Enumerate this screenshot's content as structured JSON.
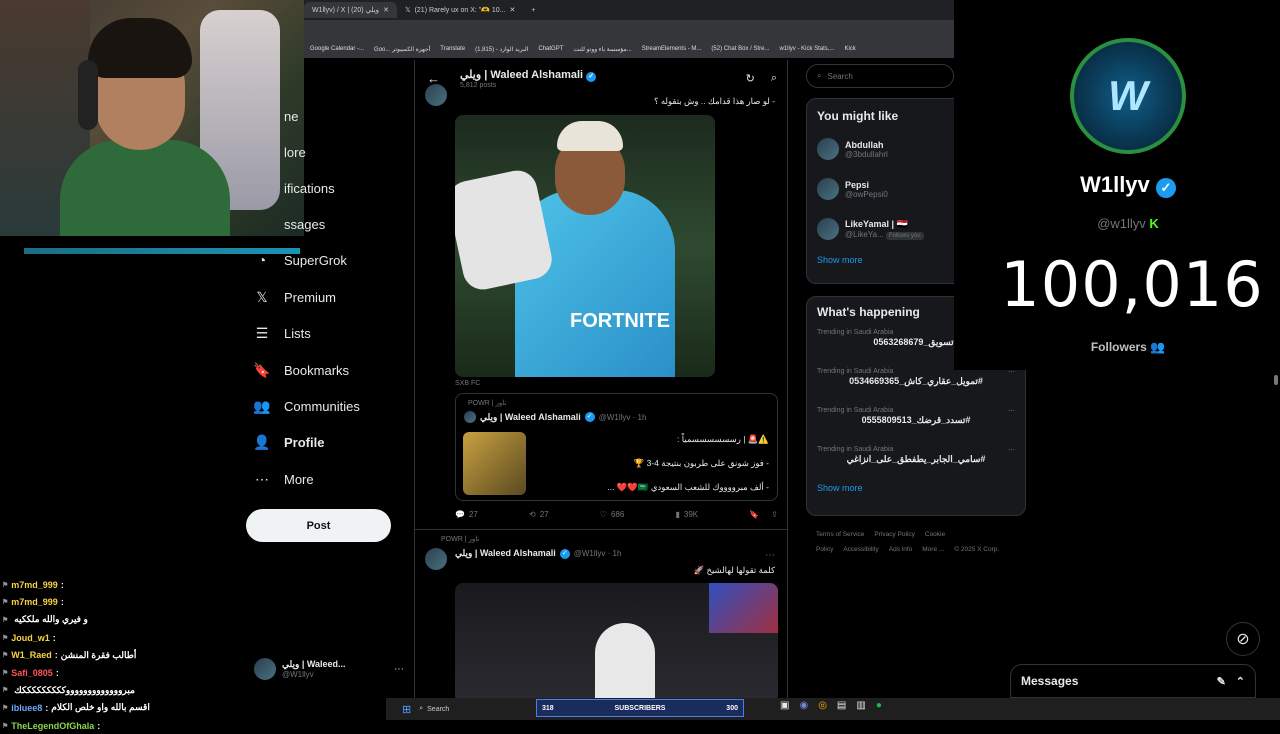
{
  "browser": {
    "tabs": [
      {
        "label": "W1llyv) / X | ويلي (20)"
      },
      {
        "label": "(21) Rarely ux on X: \"🫶 10..."
      }
    ],
    "bookmarks": [
      "Google Calendar -...",
      "Goo... أجهزة الكمبيوتر",
      "Translate",
      "البريد الوارد - (1,815)",
      "ChatGPT",
      "مؤسسة باء ووتو للنت...",
      "StreamElements - M...",
      "(52) Chat Box / Stre...",
      "w1llyv - Kick Stats,...",
      "Kick"
    ]
  },
  "nav": {
    "items": [
      {
        "label": "Home",
        "icon": "home-icon",
        "glyph": "⌂"
      },
      {
        "label": "Explore",
        "icon": "explore-icon",
        "glyph": "⌕"
      },
      {
        "label": "Notifications",
        "icon": "bell-icon",
        "glyph": "🔔"
      },
      {
        "label": "Messages",
        "icon": "envelope-icon",
        "glyph": "✉"
      },
      {
        "label": "SuperGrok",
        "icon": "grok-icon",
        "glyph": "◔"
      },
      {
        "label": "Premium",
        "icon": "x-logo-icon",
        "glyph": "𝕏"
      },
      {
        "label": "Lists",
        "icon": "lists-icon",
        "glyph": "☰"
      },
      {
        "label": "Bookmarks",
        "icon": "bookmark-icon",
        "glyph": "🔖"
      },
      {
        "label": "Communities",
        "icon": "communities-icon",
        "glyph": "👥"
      },
      {
        "label": "Profile",
        "icon": "profile-icon",
        "glyph": "👤"
      },
      {
        "label": "More",
        "icon": "more-circle-icon",
        "glyph": "⋯"
      }
    ],
    "visible_labels": [
      "ne",
      "lore",
      "ifications",
      "ssages",
      "SuperGrok",
      "Premium",
      "Lists",
      "Bookmarks",
      "Communities",
      "Profile",
      "More"
    ],
    "post_label": "Post",
    "account_name": "ويلي | Waleed...",
    "account_handle": "@W1llyv"
  },
  "feed": {
    "header_name": "ويلي | Waleed Alshamali",
    "header_posts": "5,812 posts",
    "tweet1": {
      "text": "- لو صار هذا قدامك .. وش بتقوله ؟",
      "image_caption": "SXB FC",
      "quote": {
        "repost_label": "POWR | ناور",
        "name": "ويلي | Waleed Alshamali",
        "handle": "@W1llyv · 1h",
        "line1": "⚠️🚨 | رسسسسسسمياً :",
        "line2": "- فوز شونق على طربون بنتيجة 4-3 🏆",
        "line3": "- ألف مبرووووك للشعب السعودي 🇸🇦❤️❤️ ..."
      },
      "replies": "27",
      "reposts": "27",
      "likes": "686",
      "views": "39K"
    },
    "tweet2": {
      "repost_label": "POWR | ناور",
      "name": "ويلي | Waleed Alshamali",
      "handle": "@W1llyv · 1h",
      "text": "كلمة تقولها لهالشيخ 🚀"
    }
  },
  "sidebar": {
    "search_placeholder": "Search",
    "might_like_title": "You might like",
    "people": [
      {
        "name": "Abdullah",
        "handle": "@3bdullahrl"
      },
      {
        "name": "Pepsi",
        "handle": "@owPepsi0"
      },
      {
        "name": "LikeYamal | 🇪🇬",
        "handle": "@LikeYa...",
        "badge": "Follows you"
      }
    ],
    "show_more": "Show more",
    "happening_title": "What's happening",
    "trends": [
      {
        "meta": "Trending in Saudi Arabia",
        "topic": "#تسويق_0563268679"
      },
      {
        "meta": "Trending in Saudi Arabia",
        "topic": "#تمويل_عقاري_كاش_0534669365"
      },
      {
        "meta": "Trending in Saudi Arabia",
        "topic": "#تسدد_قرضك_0555809513"
      },
      {
        "meta": "Trending in Saudi Arabia",
        "topic": "#سامي_الجابر_يطفطق_على_انزاغي"
      }
    ],
    "footer": [
      "Terms of Service",
      "Privacy Policy",
      "Cookie Policy",
      "Accessibility",
      "Ads info",
      "More ...",
      "© 2025 X Corp."
    ]
  },
  "followers_widget": {
    "name": "W1llyv",
    "handle": "@w1llyv",
    "count": "100,016",
    "label": "Followers"
  },
  "chat": [
    {
      "user": "m7md_999",
      "msg": "",
      "color": "#f5d442"
    },
    {
      "user": "m7md_999",
      "msg": "",
      "color": "#f5d442"
    },
    {
      "user": "",
      "msg": "و فيري والله ملككيه",
      "color": "#f5d442"
    },
    {
      "user": "Joud_w1",
      "msg": "",
      "color": "#f5d442"
    },
    {
      "user": "W1_Raed",
      "msg": "أطالب فقرة المنشن",
      "color": "#f5d442"
    },
    {
      "user": "Safi_0805",
      "msg": "",
      "color": "#f55"
    },
    {
      "user": "",
      "msg": "مبروووووووووووووكككككككككك",
      "color": "#fff"
    },
    {
      "user": "ibluee8",
      "msg": "اقسم بالله واو خلص الكلام",
      "color": "#6fa8ff"
    },
    {
      "user": "TheLegendOfGhala",
      "msg": "",
      "color": "#8fd44a"
    }
  ],
  "messages_label": "Messages",
  "taskbar": {
    "search_label": "Search",
    "subs_left": "318",
    "subs_label": "SUBSCRIBERS",
    "subs_right": "300"
  }
}
